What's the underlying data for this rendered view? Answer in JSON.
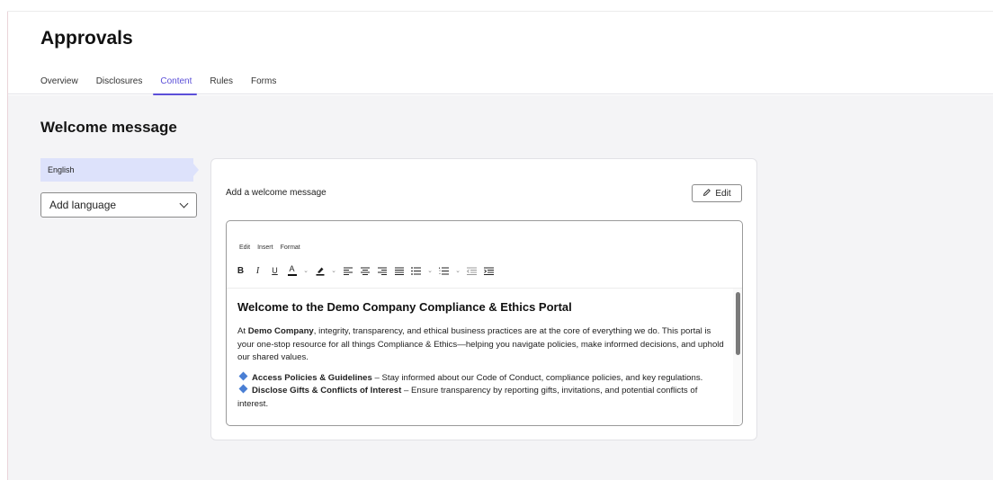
{
  "header": {
    "title": "Approvals",
    "tabs": [
      {
        "label": "Overview"
      },
      {
        "label": "Disclosures"
      },
      {
        "label": "Content",
        "active": true
      },
      {
        "label": "Rules"
      },
      {
        "label": "Forms"
      }
    ]
  },
  "main": {
    "section_title": "Welcome message",
    "languages": {
      "selected": "English",
      "add_placeholder": "Add language"
    },
    "card": {
      "label": "Add a welcome message",
      "edit_label": "Edit",
      "editor": {
        "menu": [
          "Edit",
          "Insert",
          "Format"
        ],
        "toolbar": {
          "bold": "B",
          "italic": "I",
          "underline": "U",
          "text_color": "A"
        },
        "doc": {
          "heading": "Welcome to the Demo Company Compliance & Ethics Portal",
          "intro_prefix": "At ",
          "intro_company": "Demo Company",
          "intro_rest": ", integrity, transparency, and ethical business practices are at the core of everything we do. This portal is your one-stop resource for all things Compliance & Ethics—helping you navigate policies, make informed decisions, and uphold our shared values.",
          "items": [
            {
              "bold": "Access Policies & Guidelines",
              "text": " – Stay informed about our Code of Conduct, compliance policies, and key regulations."
            },
            {
              "bold": "Disclose Gifts & Conflicts of Interest",
              "text": " – Ensure transparency by reporting gifts, invitations, and potential conflicts of interest."
            }
          ]
        }
      }
    }
  },
  "colors": {
    "accent": "#5b4fd8",
    "selected_language_bg": "#dde2fb",
    "content_bg": "#f4f4f6",
    "bullet": "#4a7fd4"
  }
}
